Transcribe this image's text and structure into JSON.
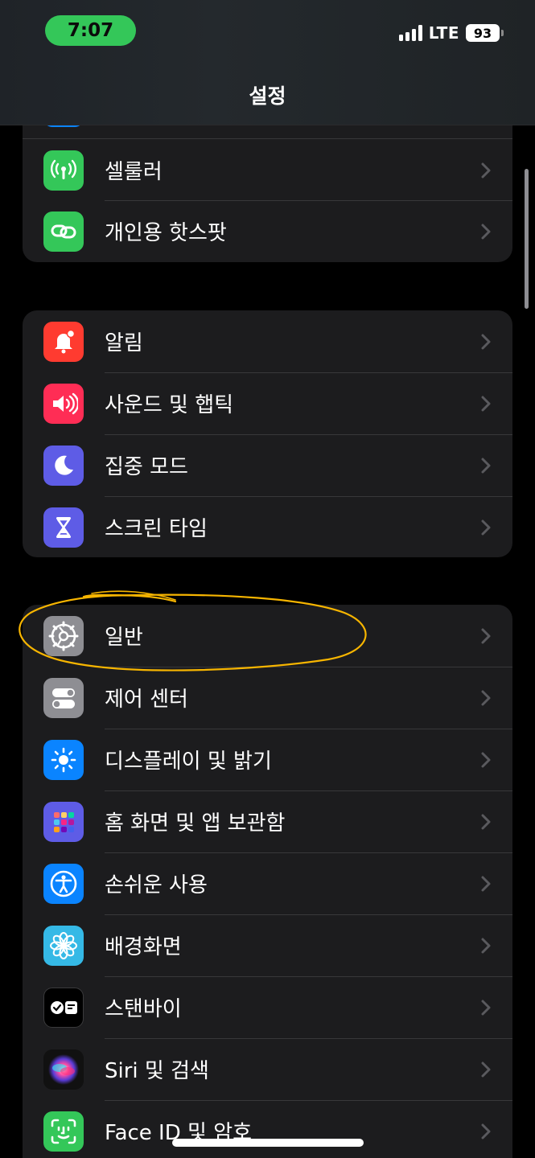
{
  "status_bar": {
    "time": "7:07",
    "network": "LTE",
    "battery": "93"
  },
  "header": {
    "title": "설정"
  },
  "groups": [
    {
      "items": [
        {
          "label": "셀룰러",
          "icon": "antenna-icon",
          "color": "#34c759"
        },
        {
          "label": "개인용 핫스팟",
          "icon": "link-icon",
          "color": "#34c759"
        }
      ]
    },
    {
      "items": [
        {
          "label": "알림",
          "icon": "bell-icon",
          "color": "#ff3b30"
        },
        {
          "label": "사운드 및 햅틱",
          "icon": "speaker-icon",
          "color": "#ff2d55"
        },
        {
          "label": "집중 모드",
          "icon": "moon-icon",
          "color": "#5e5ce6"
        },
        {
          "label": "스크린 타임",
          "icon": "hourglass-icon",
          "color": "#5e5ce6"
        }
      ]
    },
    {
      "items": [
        {
          "label": "일반",
          "icon": "gear-icon",
          "color": "#8e8e93"
        },
        {
          "label": "제어 센터",
          "icon": "toggles-icon",
          "color": "#8e8e93"
        },
        {
          "label": "디스플레이 및 밝기",
          "icon": "sun-icon",
          "color": "#0a84ff"
        },
        {
          "label": "홈 화면 및 앱 보관함",
          "icon": "app-grid-icon",
          "color": "#5e5ce6"
        },
        {
          "label": "손쉬운 사용",
          "icon": "accessibility-icon",
          "color": "#0a84ff"
        },
        {
          "label": "배경화면",
          "icon": "flower-icon",
          "color": "#35b9e6"
        },
        {
          "label": "스탠바이",
          "icon": "standby-icon",
          "color": "#000000"
        },
        {
          "label": "Siri 및 검색",
          "icon": "siri-icon",
          "color": "#1a1a1a"
        },
        {
          "label": "Face ID 및 암호",
          "icon": "face-id-icon",
          "color": "#34c759"
        }
      ]
    }
  ],
  "colors": {
    "background": "#000000",
    "group_background": "#1c1c1e",
    "separator": "#38383a",
    "time_pill": "#34c759",
    "highlight": "#f7b500"
  }
}
